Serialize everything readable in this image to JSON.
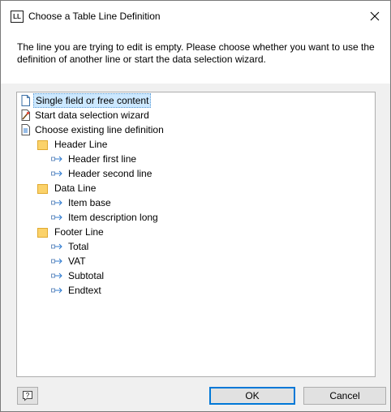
{
  "window": {
    "icon_text": "LL",
    "title": "Choose a Table Line Definition"
  },
  "message": "The line you are trying to edit is empty. Please choose whether you want to use the definition of another line or start the data selection wizard.",
  "tree": {
    "single_field": "Single field or free content",
    "start_wizard": "Start data selection wizard",
    "choose_existing": "Choose existing line definition",
    "header_line": "Header Line",
    "header_first": "Header first line",
    "header_second": "Header second line",
    "data_line": "Data Line",
    "item_base": "Item base",
    "item_desc": "Item description long",
    "footer_line": "Footer Line",
    "total": "Total",
    "vat": "VAT",
    "subtotal": "Subtotal",
    "endtext": "Endtext"
  },
  "buttons": {
    "help_glyph": "?",
    "ok": "OK",
    "cancel": "Cancel"
  },
  "colors": {
    "selection": "#cce8ff",
    "folder": "#fbd26a",
    "ok_border": "#0078d7"
  }
}
